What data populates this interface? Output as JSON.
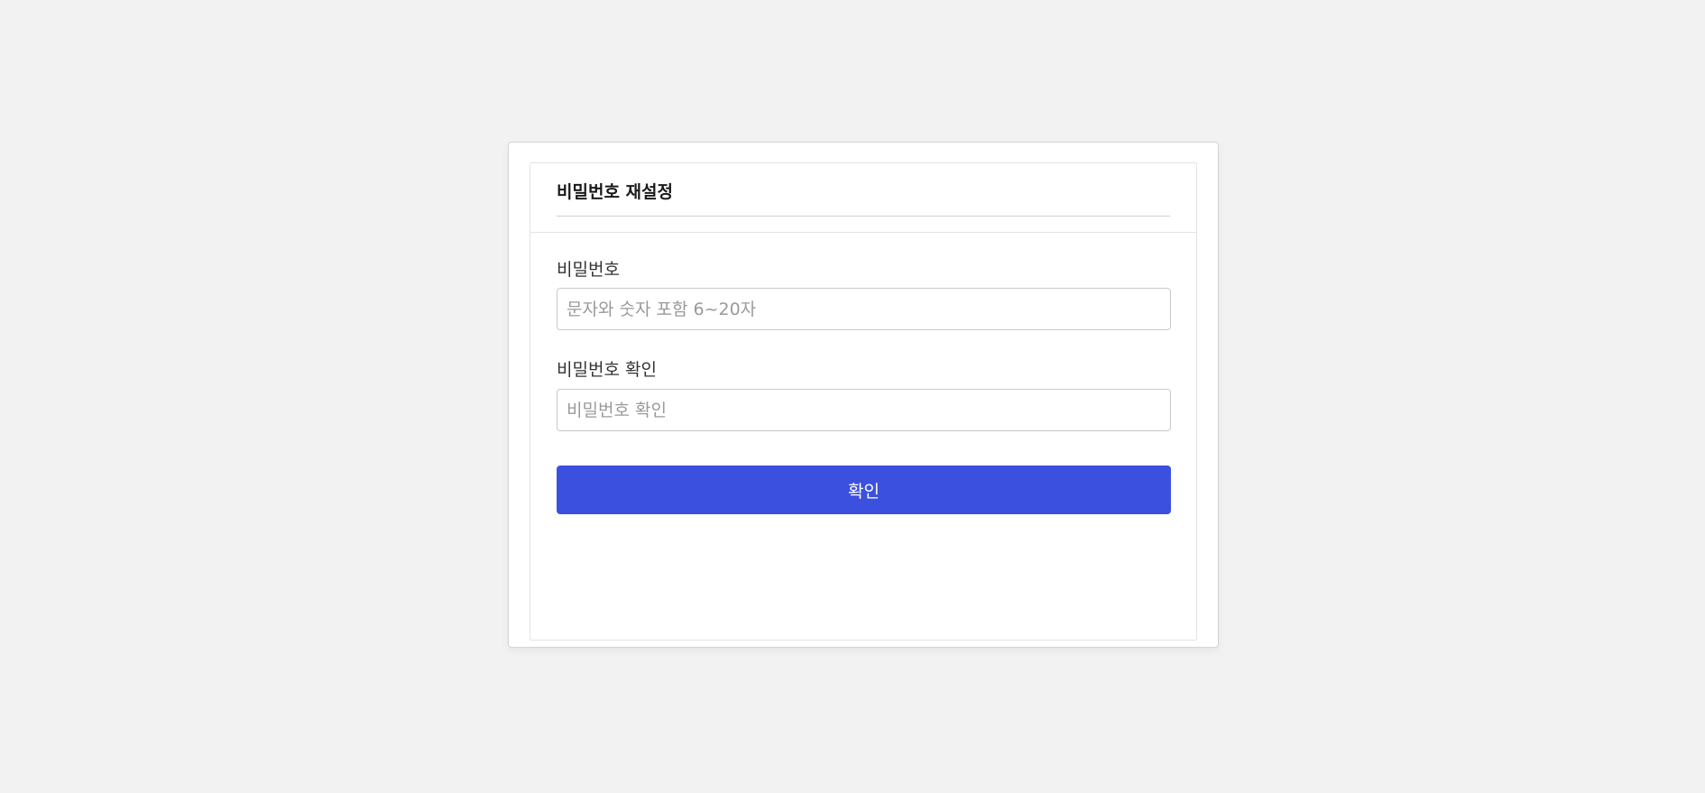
{
  "form": {
    "title": "비밀번호 재설정",
    "password": {
      "label": "비밀번호",
      "placeholder": "문자와 숫자 포함 6~20자",
      "value": ""
    },
    "password_confirm": {
      "label": "비밀번호 확인",
      "placeholder": "비밀번호 확인",
      "value": ""
    },
    "submit_label": "확인"
  },
  "colors": {
    "background": "#f2f2f2",
    "accent": "#3b50df"
  }
}
